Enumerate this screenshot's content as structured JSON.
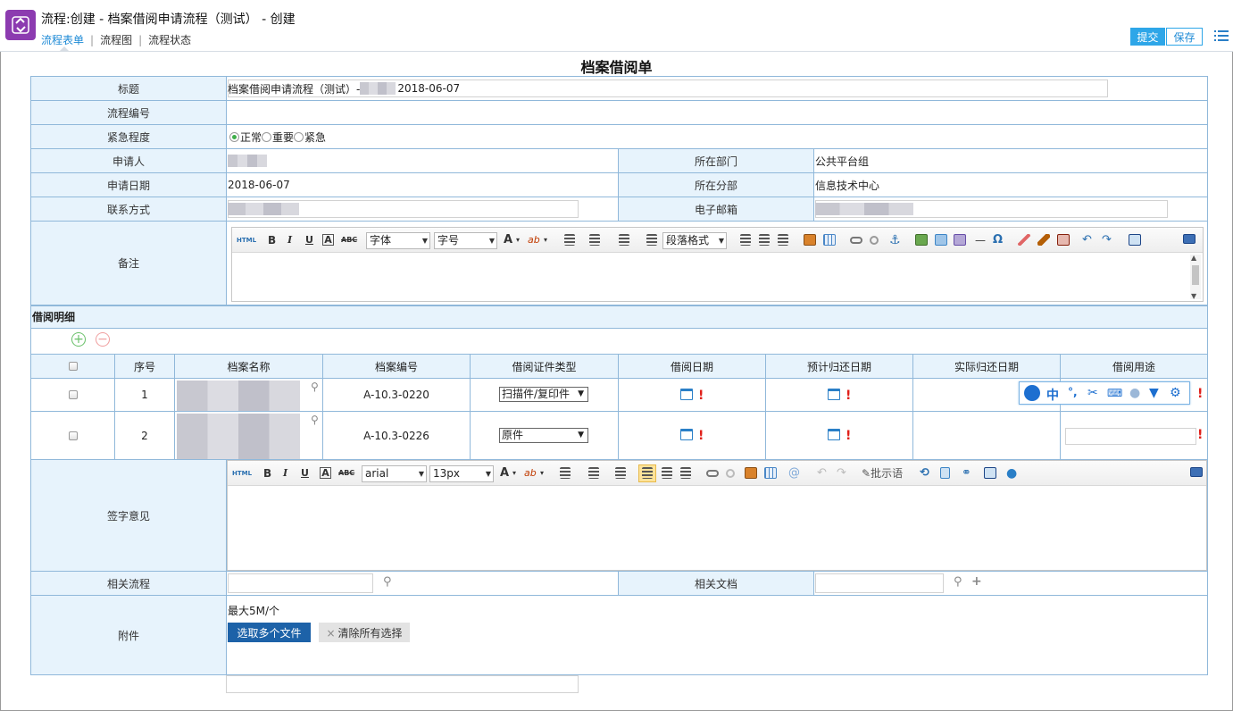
{
  "header": {
    "title": "流程:创建 - 档案借阅申请流程（测试） - 创建",
    "tabs": [
      "流程表单",
      "流程图",
      "流程状态"
    ],
    "active_tab": 0,
    "submit_label": "提交",
    "save_label": "保存"
  },
  "form": {
    "title": "档案借阅单",
    "fields": {
      "title_label": "标题",
      "title_value_prefix": "档案借阅申请流程（测试）-",
      "title_value_date": "2018-06-07",
      "process_no_label": "流程编号",
      "urgency_label": "紧急程度",
      "urgency_options": [
        "正常",
        "重要",
        "紧急"
      ],
      "urgency_selected": "正常",
      "applicant_label": "申请人",
      "department_label": "所在部门",
      "department_value": "公共平台组",
      "apply_date_label": "申请日期",
      "apply_date_value": "2018-06-07",
      "branch_label": "所在分部",
      "branch_value": "信息技术中心",
      "contact_label": "联系方式",
      "email_label": "电子邮箱",
      "remark_label": "备注"
    },
    "remark_toolbar": {
      "html": "HTML",
      "bold": "B",
      "italic": "I",
      "underline": "U",
      "textbox": "A",
      "strike": "ABC",
      "font_select": "字体",
      "size_select": "字号",
      "font_color": "A",
      "highlight": "ab",
      "paragraph_select": "段落格式",
      "omega": "Ω"
    },
    "borrow_section": {
      "title": "借阅明细",
      "columns": [
        "序号",
        "档案名称",
        "档案编号",
        "借阅证件类型",
        "借阅日期",
        "预计归还日期",
        "实际归还日期",
        "借阅用途"
      ],
      "rows": [
        {
          "index": "1",
          "archive_no": "A-10.3-0220",
          "doc_type": "扫描件/复印件"
        },
        {
          "index": "2",
          "archive_no": "A-10.3-0226",
          "doc_type": "原件"
        }
      ],
      "required_mark": "!"
    },
    "ime_bar": {
      "zh": "中"
    },
    "signature": {
      "label": "签字意见",
      "font": "arial",
      "size": "13px",
      "approve_text": "批示语"
    },
    "related_process_label": "相关流程",
    "related_doc_label": "相关文档",
    "attachment": {
      "label": "附件",
      "limit": "最大5M/个",
      "upload_button": "选取多个文件",
      "clear_button": "清除所有选择",
      "clear_icon": "×"
    }
  },
  "colors": {
    "accent": "#2ea6e8",
    "label_bg": "#e7f3fc",
    "border": "#90b8da",
    "logo": "#8c3bb0",
    "upload": "#1d62a8"
  }
}
